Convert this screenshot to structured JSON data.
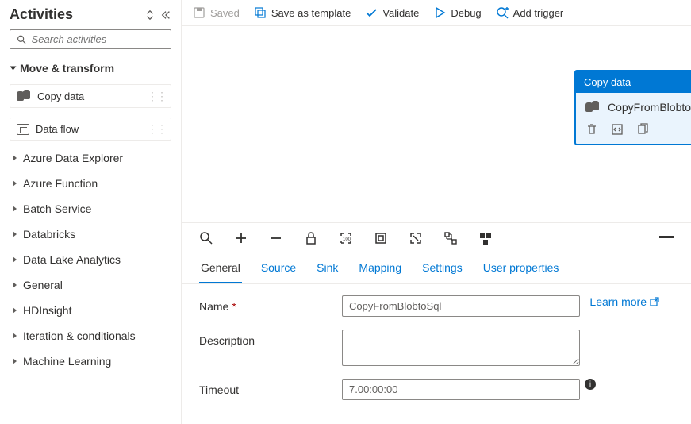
{
  "sidebar": {
    "title": "Activities",
    "search_placeholder": "Search activities",
    "section": "Move & transform",
    "items": [
      {
        "label": "Copy data"
      },
      {
        "label": "Data flow"
      }
    ],
    "categories": [
      "Azure Data Explorer",
      "Azure Function",
      "Batch Service",
      "Databricks",
      "Data Lake Analytics",
      "General",
      "HDInsight",
      "Iteration & conditionals",
      "Machine Learning"
    ]
  },
  "toolbar": {
    "saved": "Saved",
    "save_template": "Save as template",
    "validate": "Validate",
    "debug": "Debug",
    "add_trigger": "Add trigger"
  },
  "node": {
    "header": "Copy data",
    "name": "CopyFromBlobtoSql"
  },
  "tabs": {
    "general": "General",
    "source": "Source",
    "sink": "Sink",
    "mapping": "Mapping",
    "settings": "Settings",
    "user_properties": "User properties"
  },
  "form": {
    "name_label": "Name",
    "name_value": "CopyFromBlobtoSql",
    "description_label": "Description",
    "description_value": "",
    "timeout_label": "Timeout",
    "timeout_value": "7.00:00:00",
    "learn_more": "Learn more"
  }
}
